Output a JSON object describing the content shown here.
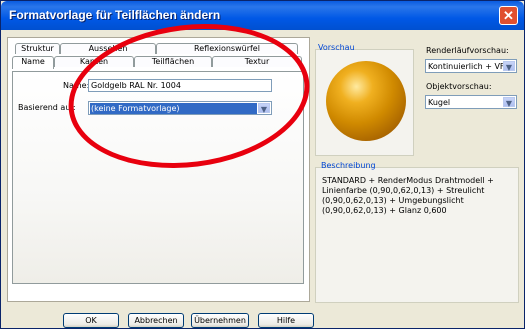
{
  "window": {
    "title": "Formatvorlage für Teilflächen ändern",
    "close": "✕"
  },
  "tabs": {
    "back_row": [
      "Struktur",
      "Aussehen",
      "Reflexionswürfel"
    ],
    "front_row": [
      "Name",
      "Kanten",
      "Teilflächen",
      "Textur"
    ],
    "active": "Name"
  },
  "form": {
    "name_label": "Name:",
    "name_value": "Goldgelb RAL Nr. 1004",
    "based_on_label": "Basierend auf:",
    "based_on_value": "(keine Formatvorlage)"
  },
  "preview": {
    "group_title": "Vorschau",
    "render_label": "Renderläufvorschau:",
    "render_value": "Kontinuierlich + VF",
    "object_label": "Objektvorschau:",
    "object_value": "Kugel"
  },
  "description": {
    "group_title": "Beschreibung",
    "text": "STANDARD + RenderModus Drahtmodell + Linienfarbe (0,90,0,62,0,13) + Streulicht (0,90,0,62,0,13) + Umgebungslicht (0,90,0,62,0,13) + Glanz 0,600"
  },
  "buttons": {
    "ok": "OK",
    "cancel": "Abbrechen",
    "apply": "Übernehmen",
    "help": "Hilfe"
  },
  "colors": {
    "annotation": "#e8000e",
    "selection": "#316ac5",
    "sphere": "#d08a00"
  }
}
